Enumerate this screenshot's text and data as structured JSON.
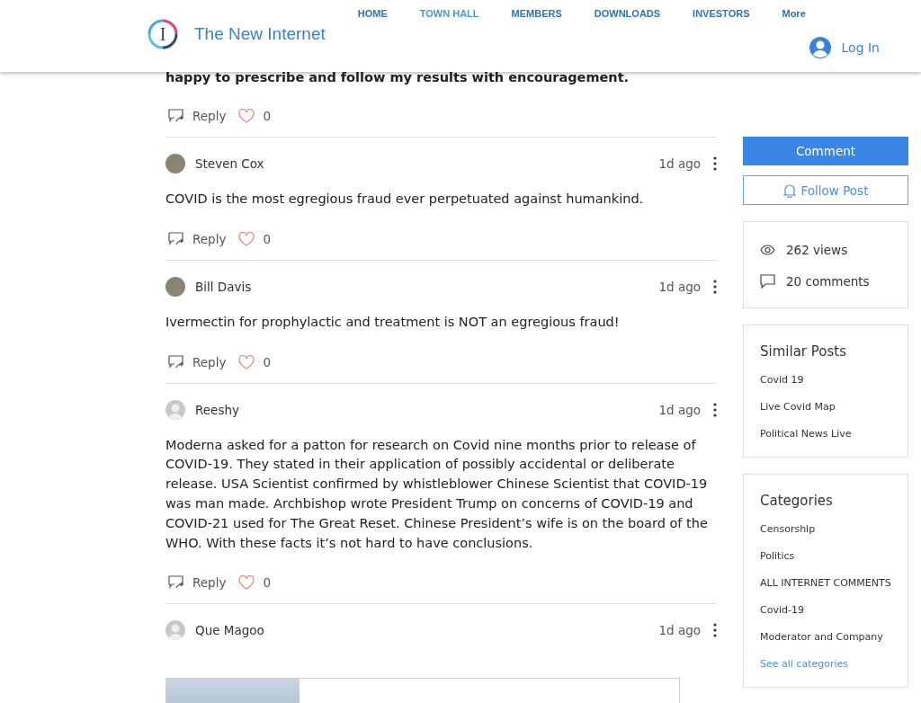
{
  "header": {
    "logo_letter": "I",
    "site_name": "The New Internet",
    "nav": [
      {
        "label": "HOME",
        "selected": false
      },
      {
        "label": "TOWN HALL",
        "selected": true
      },
      {
        "label": "MEMBERS",
        "selected": false
      },
      {
        "label": "DOWNLOADS",
        "selected": false
      },
      {
        "label": "INVESTORS",
        "selected": false
      },
      {
        "label": "More",
        "selected": false
      }
    ],
    "login": "Log In"
  },
  "partial_comment": {
    "text": "happy to prescribe and follow my results with encouragement.",
    "reply": "Reply",
    "likes": "0",
    "liked": false
  },
  "comments": [
    {
      "author": "Steven Cox",
      "avatar": {
        "kind": "photo"
      },
      "time": "1d ago",
      "text": "COVID is the most egregious fraud ever perpetuated against humankind.",
      "reply": "Reply",
      "likes": "0",
      "liked": false
    },
    {
      "author": "Bill Davis",
      "avatar": {
        "kind": "photo"
      },
      "time": "1d ago",
      "text": "Ivermectin for prophylactic and treatment is NOT an egregious fraud!",
      "reply": "Reply",
      "likes": "0",
      "liked": false
    },
    {
      "author": "Reeshy",
      "avatar": {
        "kind": "silhouette"
      },
      "time": "1d ago",
      "text": "Moderna asked for a patton for research on Covid nine months prior to release of COVID-19. They stated in their application of possibly accidental or deliberate release. USA Scientist confirmed by whistleblower Chinese Scientist that COVID-19 was man made. Archbishop wrote President Trump on concerns of COVID-19 and COVID-21 used for The Great Reset. Chinese President’s wife is on the board of the WHO. With these facts it’s not hard to have conclusions.",
      "reply": "Reply",
      "likes": "0",
      "liked": false
    },
    {
      "author": "Que Magoo",
      "avatar": {
        "kind": "silhouette"
      },
      "time": "1d ago",
      "kind": "preview"
    }
  ],
  "sidebar": {
    "comment_button": "Comment",
    "follow_button": "Follow Post",
    "stats": [
      {
        "kind": "views",
        "text": "262 views"
      },
      {
        "kind": "comments",
        "text": "20 comments"
      }
    ],
    "similar": {
      "title": "Similar Posts",
      "items": [
        "Covid 19",
        "Live Covid Map",
        "Political News Live"
      ]
    },
    "categories": {
      "title": "Categories",
      "items": [
        "Censorship",
        "Politics",
        "ALL INTERNET COMMENTS",
        "Covid-19",
        "Moderator and Company"
      ],
      "see_all": "See all categories"
    }
  }
}
